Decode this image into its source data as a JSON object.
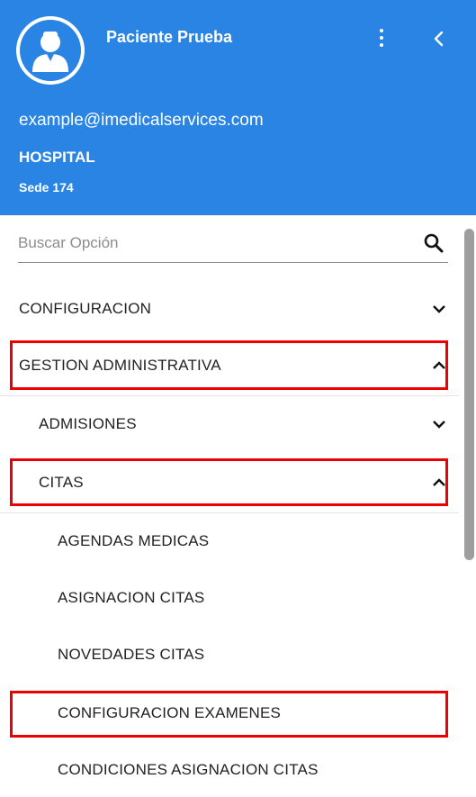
{
  "header": {
    "user_name": "Paciente Prueba",
    "email": "example@imedicalservices.com",
    "organization": "HOSPITAL",
    "branch": "Sede 174",
    "background_color": "#2a84e3"
  },
  "search": {
    "placeholder": "Buscar Opción",
    "value": "",
    "icon": "search-icon"
  },
  "menu": {
    "items": [
      {
        "label": "CONFIGURACION",
        "level": 0,
        "expanded": false,
        "highlighted": false
      },
      {
        "label": "GESTION ADMINISTRATIVA",
        "level": 0,
        "expanded": true,
        "highlighted": true
      },
      {
        "label": "ADMISIONES",
        "level": 1,
        "expanded": false,
        "highlighted": false
      },
      {
        "label": "CITAS",
        "level": 1,
        "expanded": true,
        "highlighted": true
      },
      {
        "label": "AGENDAS MEDICAS",
        "level": 2,
        "highlighted": false
      },
      {
        "label": "ASIGNACION CITAS",
        "level": 2,
        "highlighted": false
      },
      {
        "label": "NOVEDADES CITAS",
        "level": 2,
        "highlighted": false
      },
      {
        "label": "CONFIGURACION EXAMENES",
        "level": 2,
        "highlighted": true
      },
      {
        "label": "CONDICIONES ASIGNACION CITAS",
        "level": 2,
        "highlighted": false
      }
    ]
  },
  "highlight_color": "#ee0000"
}
